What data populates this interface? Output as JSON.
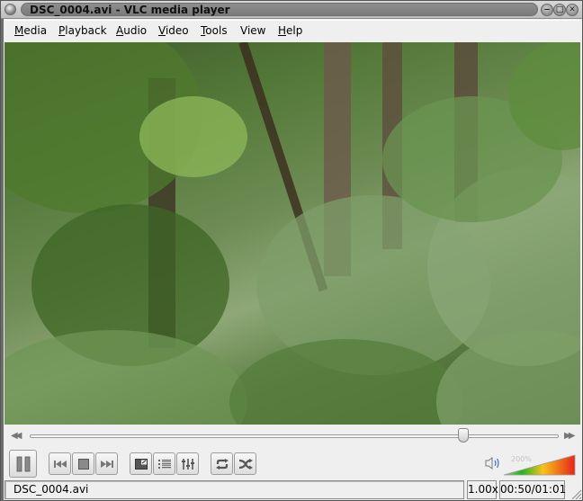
{
  "window": {
    "title": "DSC_0004.avi - VLC media player",
    "controls": {
      "minimize_icon": "minimize-icon",
      "maximize_icon": "maximize-icon",
      "close_icon": "close-icon"
    }
  },
  "menubar": {
    "items": [
      {
        "label": "Media",
        "mnemonic": "M",
        "rest": "edia"
      },
      {
        "label": "Playback",
        "mnemonic": "P",
        "rest": "layback"
      },
      {
        "label": "Audio",
        "mnemonic": "A",
        "rest": "udio"
      },
      {
        "label": "Video",
        "mnemonic": "V",
        "rest": "ideo"
      },
      {
        "label": "Tools",
        "mnemonic": "T",
        "rest": "ools"
      },
      {
        "label": "View",
        "mnemonic": "Vi",
        "rest": "ew"
      },
      {
        "label": "Help",
        "mnemonic": "H",
        "rest": "elp"
      }
    ]
  },
  "video": {
    "description": "forest scene with green leaves and tree trunks"
  },
  "seek": {
    "position_fraction": 0.82,
    "back_icon": "seek-backward-icon",
    "forward_icon": "seek-forward-icon"
  },
  "controls": {
    "buttons": [
      {
        "name": "pause-button",
        "icon": "pause-icon"
      },
      {
        "name": "previous-button",
        "icon": "skip-previous-icon"
      },
      {
        "name": "stop-button",
        "icon": "stop-icon"
      },
      {
        "name": "next-button",
        "icon": "skip-next-icon"
      },
      {
        "name": "fullscreen-button",
        "icon": "fullscreen-icon"
      },
      {
        "name": "playlist-button",
        "icon": "playlist-icon"
      },
      {
        "name": "extended-settings-button",
        "icon": "equalizer-icon"
      },
      {
        "name": "loop-button",
        "icon": "loop-icon"
      },
      {
        "name": "shuffle-button",
        "icon": "shuffle-icon"
      }
    ]
  },
  "volume": {
    "max_label": "200%",
    "level_fraction": 1.0,
    "icon": "speaker-icon"
  },
  "status": {
    "filename": "DSC_0004.avi",
    "rate": "1.00x",
    "time": "00:50/01:01"
  }
}
